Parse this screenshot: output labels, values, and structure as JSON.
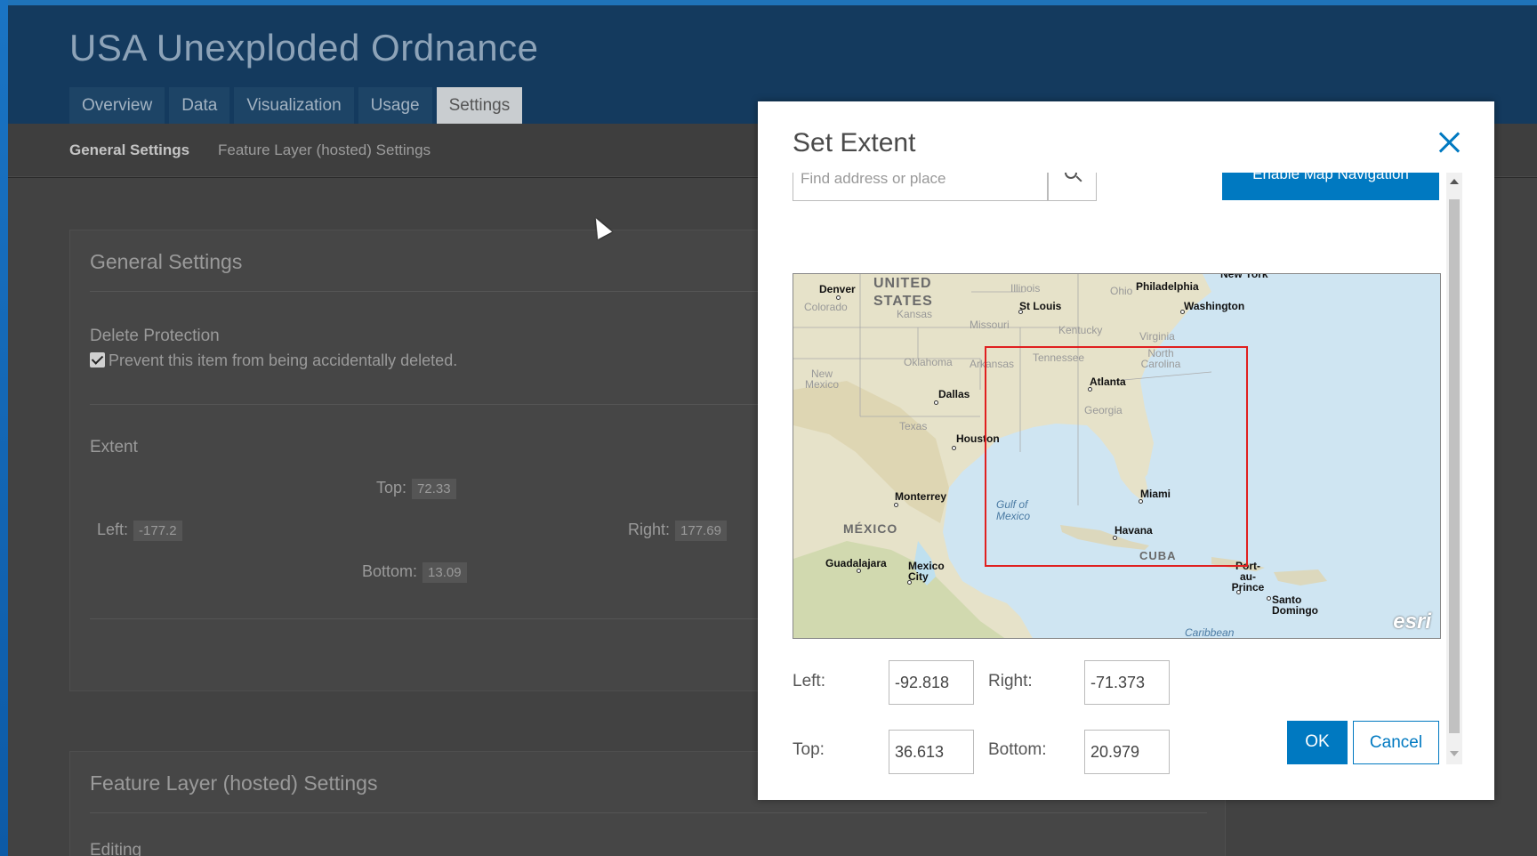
{
  "app": {
    "title": "USA Unexploded Ordnance"
  },
  "tabs": [
    {
      "label": "Overview"
    },
    {
      "label": "Data"
    },
    {
      "label": "Visualization"
    },
    {
      "label": "Usage"
    },
    {
      "label": "Settings"
    }
  ],
  "subnav": [
    {
      "label": "General Settings"
    },
    {
      "label": "Feature Layer (hosted) Settings"
    }
  ],
  "general": {
    "title": "General Settings",
    "delete_protection_label": "Delete Protection",
    "delete_protection_text": "Prevent this item from being accidentally deleted.",
    "extent_label": "Extent",
    "top_label": "Top:",
    "top_value": "72.33",
    "left_label": "Left:",
    "left_value": "-177.2",
    "right_label": "Right:",
    "right_value": "177.69",
    "bottom_label": "Bottom:",
    "bottom_value": "13.09"
  },
  "feature_layer": {
    "title": "Feature Layer (hosted) Settings",
    "editing_label": "Editing"
  },
  "modal": {
    "title": "Set Extent",
    "search_placeholder": "Find address or place",
    "enable_nav_label": "Enable Map Navigation",
    "left_label": "Left:",
    "left_value": "-92.818",
    "right_label": "Right:",
    "right_value": "-71.373",
    "top_label": "Top:",
    "top_value": "36.613",
    "bottom_label": "Bottom:",
    "bottom_value": "20.979",
    "ok_label": "OK",
    "cancel_label": "Cancel"
  },
  "map": {
    "attribution": "esri",
    "labels": {
      "denver": "Denver",
      "colorado": "Colorado",
      "united": "UNITED",
      "states": "STATES",
      "kansas": "Kansas",
      "illinois": "Illinois",
      "ohio": "Ohio",
      "philadelphia": "Philadelphia",
      "newyork": "New York",
      "stlouis": "St Louis",
      "washington": "Washington",
      "missouri": "Missouri",
      "kentucky": "Kentucky",
      "virginia": "Virginia",
      "oklahoma": "Oklahoma",
      "arkansas": "Arkansas",
      "tennessee": "Tennessee",
      "northcarolina": "North Carolina",
      "newmexico": "New Mexico",
      "dallas": "Dallas",
      "atlanta": "Atlanta",
      "georgia": "Georgia",
      "texas": "Texas",
      "houston": "Houston",
      "monterrey": "Monterrey",
      "gulf": "Gulf of Mexico",
      "miami": "Miami",
      "mexico": "MÉXICO",
      "havana": "Havana",
      "cuba": "CUBA",
      "guadalajara": "Guadalajara",
      "mexicocity": "Mexico City",
      "portauprince": "Port-au-Prince",
      "santodomingo": "Santo Domingo",
      "caribbean": "Caribbean"
    }
  }
}
